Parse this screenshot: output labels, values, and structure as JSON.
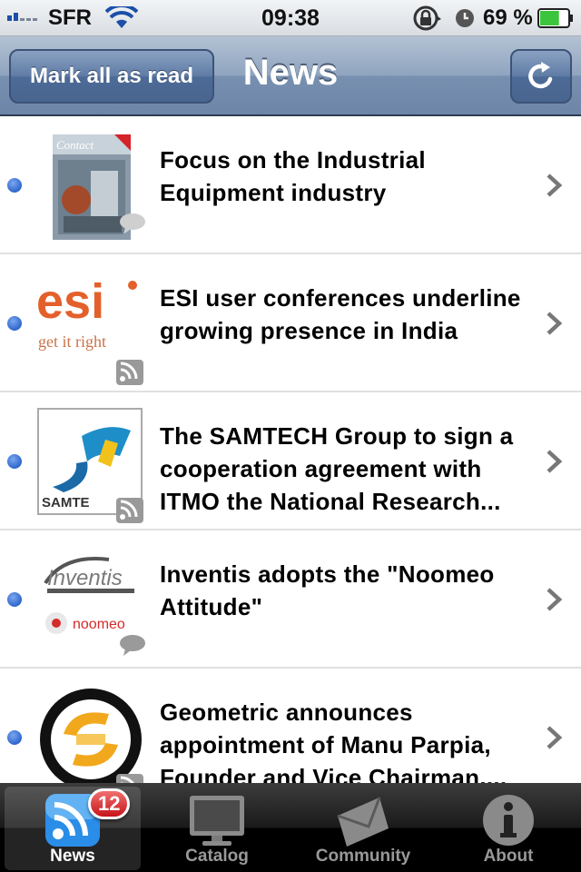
{
  "status_bar": {
    "carrier": "SFR",
    "time": "09:38",
    "battery_percent": "69 %",
    "battery_level": 0.69,
    "signal_bars": 2
  },
  "nav_bar": {
    "title": "News",
    "mark_all_label": "Mark all as read",
    "refresh_icon": "refresh-icon"
  },
  "news": [
    {
      "title": "Focus on the Industrial Equipment industry",
      "thumb": "contact-magazine-thumbnail",
      "thumb_text": "Contact",
      "unread": true,
      "overlay_icon": "comment-icon"
    },
    {
      "title": "ESI user conferences underline growing presence in India",
      "thumb": "esi-logo",
      "thumb_text": "esi",
      "thumb_tagline": "get it right",
      "unread": true,
      "overlay_icon": "rss-icon"
    },
    {
      "title": "The SAMTECH Group to sign a cooperation agreement with ITMO the National Research...",
      "thumb": "samtech-logo",
      "thumb_text": "SAMTE",
      "unread": true,
      "overlay_icon": "rss-icon"
    },
    {
      "title": "Inventis adopts the \"Noomeo Attitude\"",
      "thumb": "inventis-noomeo-logo",
      "thumb_text": "Inventis",
      "thumb_tagline": "noomeo",
      "unread": true,
      "overlay_icon": "comment-icon"
    },
    {
      "title": "Geometric  announces appointment of Manu Parpia, Founder  and Vice Chairman,...",
      "thumb": "geometric-logo",
      "unread": true,
      "overlay_icon": "rss-icon"
    }
  ],
  "tab_bar": {
    "tabs": [
      {
        "label": "News",
        "icon": "rss-icon",
        "badge": "12",
        "active": true
      },
      {
        "label": "Catalog",
        "icon": "monitor-icon",
        "active": false
      },
      {
        "label": "Community",
        "icon": "envelope-icon",
        "active": false
      },
      {
        "label": "About",
        "icon": "info-icon",
        "active": false
      }
    ]
  },
  "colors": {
    "nav_blue": "#7890b0",
    "unread_dot": "#2f66cd",
    "badge_red": "#c8141a"
  }
}
